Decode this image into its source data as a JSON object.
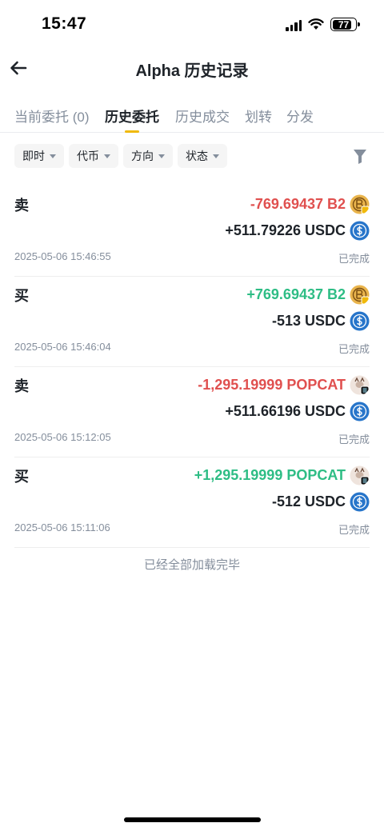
{
  "status_bar": {
    "time": "15:47",
    "battery": "77"
  },
  "header": {
    "title": "Alpha 历史记录"
  },
  "tabs": [
    {
      "label": "当前委托 (0)"
    },
    {
      "label": "历史委托"
    },
    {
      "label": "历史成交"
    },
    {
      "label": "划转"
    },
    {
      "label": "分发"
    }
  ],
  "filters": [
    {
      "label": "即时"
    },
    {
      "label": "代币"
    },
    {
      "label": "方向"
    },
    {
      "label": "状态"
    }
  ],
  "orders": [
    {
      "side": "卖",
      "amount_primary": "-769.69437 B2",
      "amount_quote": "+511.79226 USDC",
      "time": "2025-05-06 15:46:55",
      "status": "已完成",
      "token": "B2",
      "direction": "sell"
    },
    {
      "side": "买",
      "amount_primary": "+769.69437 B2",
      "amount_quote": "-513 USDC",
      "time": "2025-05-06 15:46:04",
      "status": "已完成",
      "token": "B2",
      "direction": "buy"
    },
    {
      "side": "卖",
      "amount_primary": "-1,295.19999 POPCAT",
      "amount_quote": "+511.66196 USDC",
      "time": "2025-05-06 15:12:05",
      "status": "已完成",
      "token": "POPCAT",
      "direction": "sell"
    },
    {
      "side": "买",
      "amount_primary": "+1,295.19999 POPCAT",
      "amount_quote": "-512 USDC",
      "time": "2025-05-06 15:11:06",
      "status": "已完成",
      "token": "POPCAT",
      "direction": "buy"
    }
  ],
  "footer": {
    "end_text": "已经全部加载完毕"
  },
  "colors": {
    "sell": "#e0504f",
    "buy": "#2ebd85",
    "accent": "#f0b90b",
    "muted": "#848e9c",
    "usdc": "#2775ca"
  },
  "icons": {
    "back": "arrow-left-icon",
    "filter": "funnel-icon",
    "b2": "b2-token-icon",
    "popcat": "popcat-token-icon",
    "usdc": "usdc-token-icon"
  }
}
